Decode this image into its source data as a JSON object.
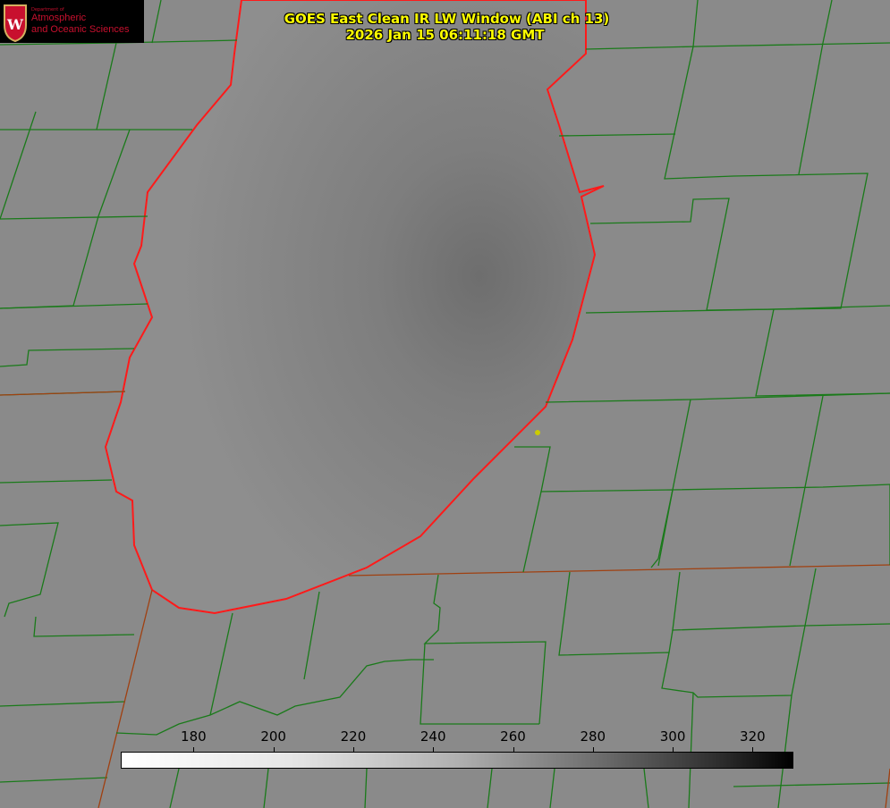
{
  "logo": {
    "department": "Department of",
    "line1": "Atmospheric",
    "line2": "and Oceanic Sciences",
    "letter": "W"
  },
  "title": {
    "line1": "GOES East Clean IR LW Window (ABI ch 13)",
    "line2": "2026 Jan 15 06:11:18 GMT"
  },
  "colorbar": {
    "min": 162,
    "max": 330,
    "ticks": [
      180,
      200,
      220,
      240,
      260,
      280,
      300,
      320
    ]
  },
  "colors": {
    "county_lines": "#1a7a1a",
    "coastline": "#ff1a1a",
    "title": "#ffff00",
    "marker": "#cccc00"
  }
}
